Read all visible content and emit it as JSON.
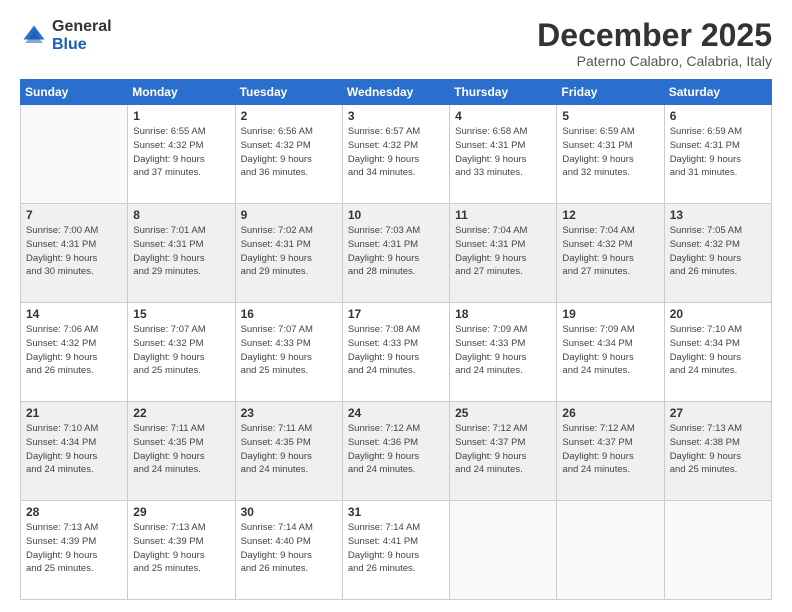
{
  "logo": {
    "general": "General",
    "blue": "Blue"
  },
  "header": {
    "month": "December 2025",
    "location": "Paterno Calabro, Calabria, Italy"
  },
  "weekdays": [
    "Sunday",
    "Monday",
    "Tuesday",
    "Wednesday",
    "Thursday",
    "Friday",
    "Saturday"
  ],
  "weeks": [
    [
      {
        "day": "",
        "info": ""
      },
      {
        "day": "1",
        "info": "Sunrise: 6:55 AM\nSunset: 4:32 PM\nDaylight: 9 hours\nand 37 minutes."
      },
      {
        "day": "2",
        "info": "Sunrise: 6:56 AM\nSunset: 4:32 PM\nDaylight: 9 hours\nand 36 minutes."
      },
      {
        "day": "3",
        "info": "Sunrise: 6:57 AM\nSunset: 4:32 PM\nDaylight: 9 hours\nand 34 minutes."
      },
      {
        "day": "4",
        "info": "Sunrise: 6:58 AM\nSunset: 4:31 PM\nDaylight: 9 hours\nand 33 minutes."
      },
      {
        "day": "5",
        "info": "Sunrise: 6:59 AM\nSunset: 4:31 PM\nDaylight: 9 hours\nand 32 minutes."
      },
      {
        "day": "6",
        "info": "Sunrise: 6:59 AM\nSunset: 4:31 PM\nDaylight: 9 hours\nand 31 minutes."
      }
    ],
    [
      {
        "day": "7",
        "info": "Sunrise: 7:00 AM\nSunset: 4:31 PM\nDaylight: 9 hours\nand 30 minutes."
      },
      {
        "day": "8",
        "info": "Sunrise: 7:01 AM\nSunset: 4:31 PM\nDaylight: 9 hours\nand 29 minutes."
      },
      {
        "day": "9",
        "info": "Sunrise: 7:02 AM\nSunset: 4:31 PM\nDaylight: 9 hours\nand 29 minutes."
      },
      {
        "day": "10",
        "info": "Sunrise: 7:03 AM\nSunset: 4:31 PM\nDaylight: 9 hours\nand 28 minutes."
      },
      {
        "day": "11",
        "info": "Sunrise: 7:04 AM\nSunset: 4:31 PM\nDaylight: 9 hours\nand 27 minutes."
      },
      {
        "day": "12",
        "info": "Sunrise: 7:04 AM\nSunset: 4:32 PM\nDaylight: 9 hours\nand 27 minutes."
      },
      {
        "day": "13",
        "info": "Sunrise: 7:05 AM\nSunset: 4:32 PM\nDaylight: 9 hours\nand 26 minutes."
      }
    ],
    [
      {
        "day": "14",
        "info": "Sunrise: 7:06 AM\nSunset: 4:32 PM\nDaylight: 9 hours\nand 26 minutes."
      },
      {
        "day": "15",
        "info": "Sunrise: 7:07 AM\nSunset: 4:32 PM\nDaylight: 9 hours\nand 25 minutes."
      },
      {
        "day": "16",
        "info": "Sunrise: 7:07 AM\nSunset: 4:33 PM\nDaylight: 9 hours\nand 25 minutes."
      },
      {
        "day": "17",
        "info": "Sunrise: 7:08 AM\nSunset: 4:33 PM\nDaylight: 9 hours\nand 24 minutes."
      },
      {
        "day": "18",
        "info": "Sunrise: 7:09 AM\nSunset: 4:33 PM\nDaylight: 9 hours\nand 24 minutes."
      },
      {
        "day": "19",
        "info": "Sunrise: 7:09 AM\nSunset: 4:34 PM\nDaylight: 9 hours\nand 24 minutes."
      },
      {
        "day": "20",
        "info": "Sunrise: 7:10 AM\nSunset: 4:34 PM\nDaylight: 9 hours\nand 24 minutes."
      }
    ],
    [
      {
        "day": "21",
        "info": "Sunrise: 7:10 AM\nSunset: 4:34 PM\nDaylight: 9 hours\nand 24 minutes."
      },
      {
        "day": "22",
        "info": "Sunrise: 7:11 AM\nSunset: 4:35 PM\nDaylight: 9 hours\nand 24 minutes."
      },
      {
        "day": "23",
        "info": "Sunrise: 7:11 AM\nSunset: 4:35 PM\nDaylight: 9 hours\nand 24 minutes."
      },
      {
        "day": "24",
        "info": "Sunrise: 7:12 AM\nSunset: 4:36 PM\nDaylight: 9 hours\nand 24 minutes."
      },
      {
        "day": "25",
        "info": "Sunrise: 7:12 AM\nSunset: 4:37 PM\nDaylight: 9 hours\nand 24 minutes."
      },
      {
        "day": "26",
        "info": "Sunrise: 7:12 AM\nSunset: 4:37 PM\nDaylight: 9 hours\nand 24 minutes."
      },
      {
        "day": "27",
        "info": "Sunrise: 7:13 AM\nSunset: 4:38 PM\nDaylight: 9 hours\nand 25 minutes."
      }
    ],
    [
      {
        "day": "28",
        "info": "Sunrise: 7:13 AM\nSunset: 4:39 PM\nDaylight: 9 hours\nand 25 minutes."
      },
      {
        "day": "29",
        "info": "Sunrise: 7:13 AM\nSunset: 4:39 PM\nDaylight: 9 hours\nand 25 minutes."
      },
      {
        "day": "30",
        "info": "Sunrise: 7:14 AM\nSunset: 4:40 PM\nDaylight: 9 hours\nand 26 minutes."
      },
      {
        "day": "31",
        "info": "Sunrise: 7:14 AM\nSunset: 4:41 PM\nDaylight: 9 hours\nand 26 minutes."
      },
      {
        "day": "",
        "info": ""
      },
      {
        "day": "",
        "info": ""
      },
      {
        "day": "",
        "info": ""
      }
    ]
  ],
  "row_shading": [
    false,
    true,
    false,
    true,
    false
  ]
}
